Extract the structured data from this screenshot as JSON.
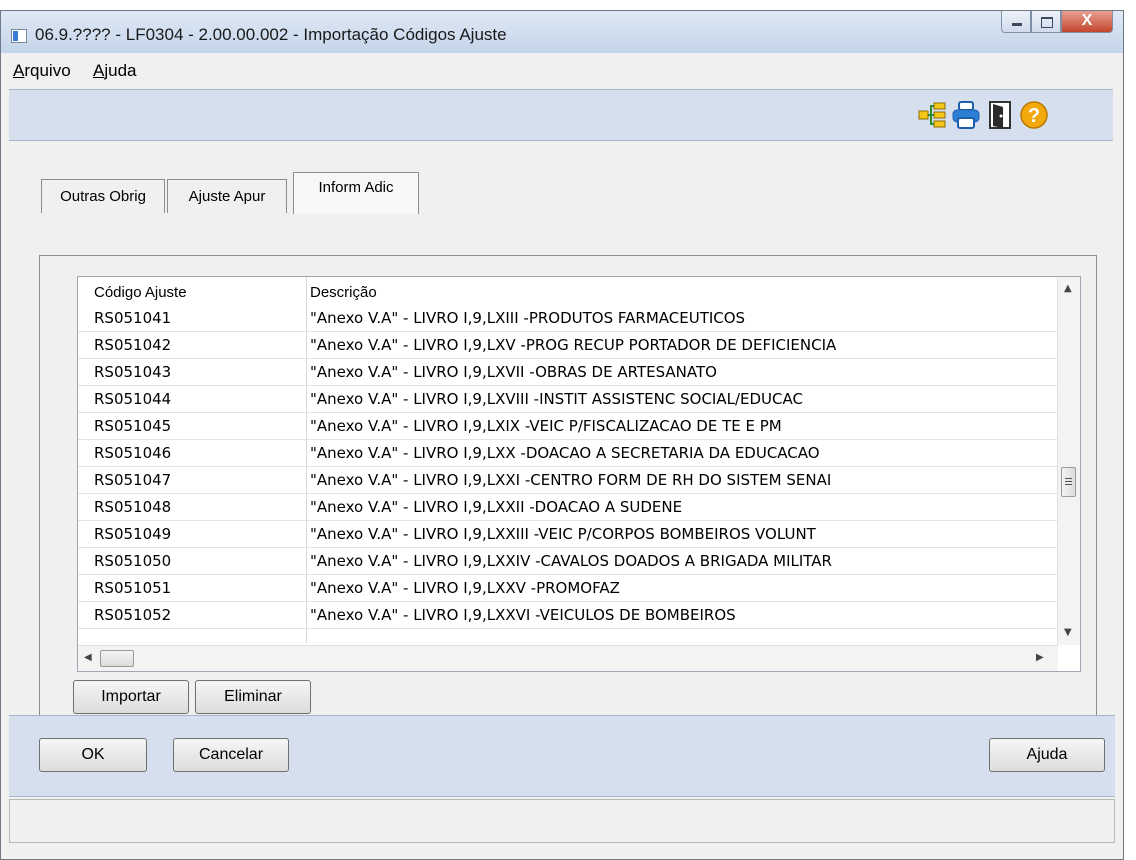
{
  "window": {
    "title": "06.9.???? - LF0304 - 2.00.00.002 - Importação Códigos Ajuste",
    "close_label": "X"
  },
  "menu": {
    "items": [
      {
        "label": "Arquivo",
        "mnemonic": "A",
        "rest": "rquivo"
      },
      {
        "label": "Ajuda",
        "mnemonic": "A",
        "rest": "juda"
      }
    ]
  },
  "toolbar": {
    "icons": [
      "tree-structure-icon",
      "printer-icon",
      "exit-door-icon",
      "help-question-icon"
    ]
  },
  "tabs": [
    {
      "label": "Outras Obrig",
      "active": false
    },
    {
      "label": "Ajuste Apur",
      "active": false
    },
    {
      "label": "Inform Adic",
      "active": true
    }
  ],
  "grid": {
    "columns": [
      "Código Ajuste",
      "Descrição"
    ],
    "rows": [
      {
        "code": "RS051041",
        "desc": "\"Anexo V.A\" - LIVRO I,9,LXIII -PRODUTOS FARMACEUTICOS"
      },
      {
        "code": "RS051042",
        "desc": "\"Anexo V.A\" - LIVRO I,9,LXV -PROG RECUP PORTADOR DE DEFICIENCIA"
      },
      {
        "code": "RS051043",
        "desc": "\"Anexo V.A\" - LIVRO I,9,LXVII -OBRAS DE ARTESANATO"
      },
      {
        "code": "RS051044",
        "desc": "\"Anexo V.A\" - LIVRO I,9,LXVIII -INSTIT ASSISTENC SOCIAL/EDUCAC"
      },
      {
        "code": "RS051045",
        "desc": "\"Anexo V.A\" - LIVRO I,9,LXIX -VEIC P/FISCALIZACAO DE TE E PM"
      },
      {
        "code": "RS051046",
        "desc": "\"Anexo V.A\" - LIVRO I,9,LXX -DOACAO A SECRETARIA DA EDUCACAO"
      },
      {
        "code": "RS051047",
        "desc": "\"Anexo V.A\" - LIVRO I,9,LXXI -CENTRO FORM DE RH DO SISTEM SENAI"
      },
      {
        "code": "RS051048",
        "desc": "\"Anexo V.A\" - LIVRO I,9,LXXII -DOACAO A SUDENE"
      },
      {
        "code": "RS051049",
        "desc": "\"Anexo V.A\" - LIVRO I,9,LXXIII -VEIC P/CORPOS BOMBEIROS VOLUNT"
      },
      {
        "code": "RS051050",
        "desc": "\"Anexo V.A\" - LIVRO I,9,LXXIV -CAVALOS DOADOS A BRIGADA MILITAR"
      },
      {
        "code": "RS051051",
        "desc": "\"Anexo V.A\" - LIVRO I,9,LXXV -PROMOFAZ"
      },
      {
        "code": "RS051052",
        "desc": "\"Anexo V.A\" - LIVRO I,9,LXXVI -VEICULOS DE BOMBEIROS"
      }
    ]
  },
  "panel_buttons": {
    "import_label": "Importar",
    "delete_label": "Eliminar"
  },
  "footer": {
    "ok_label": "OK",
    "cancel_label": "Cancelar",
    "help_label": "Ajuda"
  }
}
